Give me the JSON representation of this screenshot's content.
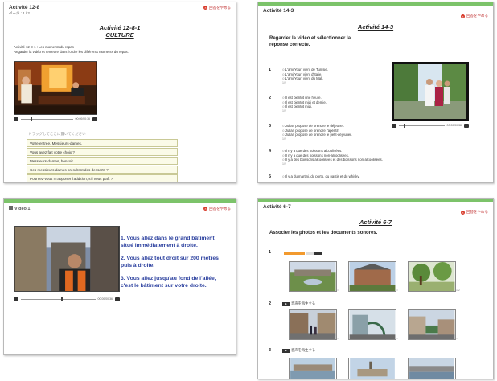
{
  "common": {
    "quit_label": "回答をやめる",
    "quit_icon": "close-circle-icon"
  },
  "panel1": {
    "header": "Activité 12-8",
    "page": "ページ : 1 / 2",
    "title_line1": "Activité 12-8-1",
    "title_line2": "CULTURE",
    "desc_line1": "Activité 12-8-1 : Les moments du repas",
    "desc_line2": "Regarder la vidéo et remettre dans l'ordre les différents moments du repas.",
    "player_time": "00:00/00:36",
    "drop_hint": "ドラッグしてここに置いてください",
    "items": [
      "Votre entrée, Messieurs-dames.",
      "Vous avez fait votre choix ?",
      "Messieurs-dames, bonsoir.",
      "Ces messieurs-dames prendront des desserts ?",
      "Pourriez-vous m'apporter l'addition, s'il vous plaît ?"
    ]
  },
  "panel2": {
    "header": "Activité 14-3",
    "title": "Activité 14-3",
    "instruction_line1": "Regarder la vidéo et sélectionner la",
    "instruction_line2": "réponse correcte.",
    "player_time": "00:00/00:38",
    "questions": [
      {
        "num": "1",
        "options": [
          "L'ami Youri vient de Tunisie.",
          "L'ami Youri vient d'Italie.",
          "L'ami Youri vient du Mali."
        ],
        "score": "1/2"
      },
      {
        "num": "2",
        "options": [
          "Il est bientôt une heure.",
          "Il est bientôt midi et demie.",
          "Il est bientôt midi."
        ],
        "score": "1/2"
      },
      {
        "num": "3",
        "options": [
          "Julian propose de prendre le déjeuner.",
          "Julian propose de prendre l'apéritif.",
          "Julian propose de prendre le petit-déjeuner."
        ],
        "score": "1/2"
      },
      {
        "num": "4",
        "options": [
          "Il n'y a que des boissons alcoolisées.",
          "Il n'y a que des boissons non-alcoolisées.",
          "Il y a des boissons alcoolisées et des boissons non-alcoolisées."
        ],
        "score": "1/2"
      },
      {
        "num": "5",
        "options": [
          "Il y a du martini, du porto, du pastis et du whisky."
        ],
        "score": ""
      }
    ]
  },
  "panel3": {
    "header": "Vidéo 1",
    "player_time": "00:00/00:36",
    "lines": [
      "1. Vous allez dans le grand bâtiment",
      "situé immédiatement à droite.",
      "2. Vous allez tout droit sur 200 mètres",
      "puis à droite.",
      "3. Vous allez jusqu'au fond de l'allée,",
      "c'est le bâtiment sur votre droite."
    ]
  },
  "panel4": {
    "header": "Activité 6-7",
    "title": "Activité 6-7",
    "instruction": "Associer les photos et les documents sonores.",
    "play_label": "音声を再生する",
    "rows": [
      {
        "num": "1",
        "score": "1/2"
      },
      {
        "num": "2",
        "score": ""
      },
      {
        "num": "3",
        "score": ""
      }
    ]
  }
}
